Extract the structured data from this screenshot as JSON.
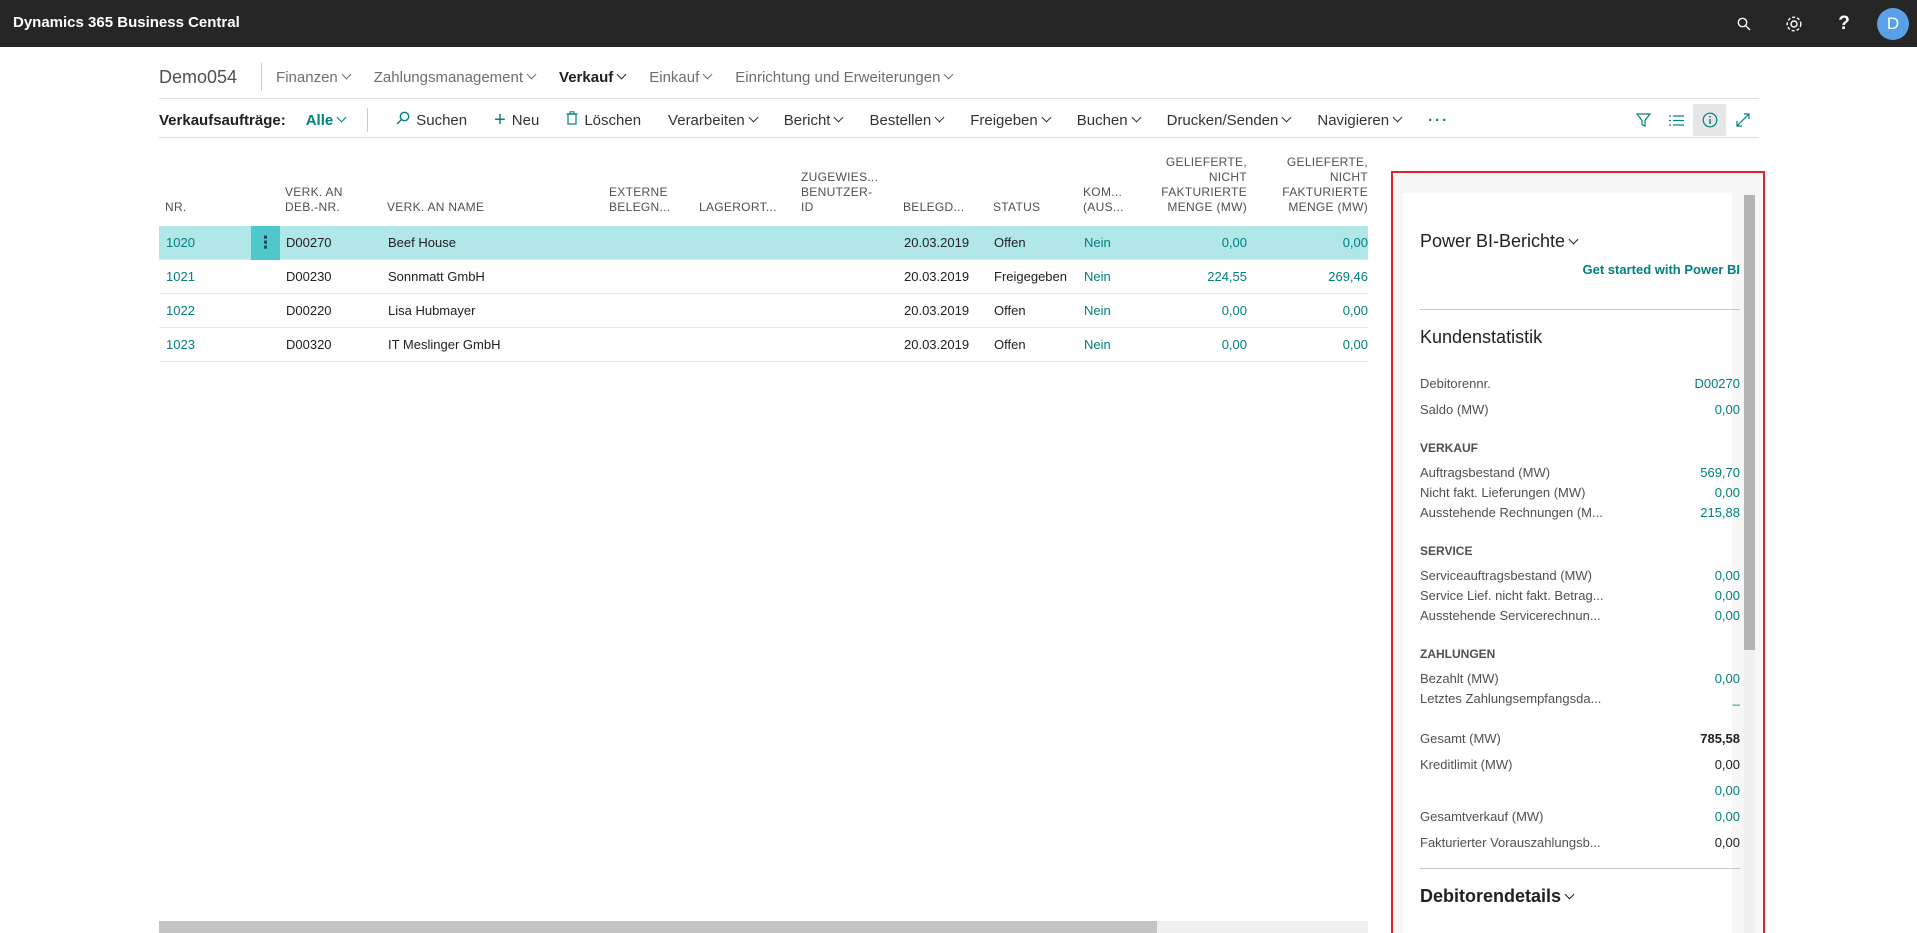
{
  "app": {
    "title": "Dynamics 365 Business Central",
    "avatar_initial": "D",
    "accent": "#00807e",
    "selected_row_color": "#b1e7e8",
    "highlight_border": "#e0242c"
  },
  "topbar_icons": [
    "search-icon",
    "gear-icon",
    "help-icon"
  ],
  "nav": {
    "company": "Demo054",
    "items": [
      {
        "label": "Finanzen",
        "active": false
      },
      {
        "label": "Zahlungsmanagement",
        "active": false
      },
      {
        "label": "Verkauf",
        "active": true
      },
      {
        "label": "Einkauf",
        "active": false
      },
      {
        "label": "Einrichtung und Erweiterungen",
        "active": false
      }
    ]
  },
  "actions": {
    "page_label": "Verkaufsaufträge:",
    "filter": "Alle",
    "search": "Suchen",
    "new": "Neu",
    "delete": "Löschen",
    "menus": [
      "Verarbeiten",
      "Bericht",
      "Bestellen",
      "Freigeben",
      "Buchen",
      "Drucken/Senden",
      "Navigieren"
    ],
    "more": "···"
  },
  "table": {
    "headers": {
      "nr": "NR.",
      "deb_nr": [
        "VERK. AN",
        "DEB.-NR."
      ],
      "name": "VERK. AN NAME",
      "ext": [
        "EXTERNE",
        "BELEGN..."
      ],
      "lager": "LAGERORT...",
      "zugew": [
        "ZUGEWIES...",
        "BENUTZER-",
        "ID"
      ],
      "belegd": "BELEGD...",
      "status": "STATUS",
      "kom": [
        "KOM...",
        "(AUS..."
      ],
      "gel1": [
        "GELIEFERTE,",
        "NICHT",
        "FAKTURIERTE",
        "MENGE (MW)"
      ],
      "gel2": [
        "GELIEFERTE,",
        "NICHT",
        "FAKTURIERTE",
        "MENGE (MW)"
      ]
    },
    "rows": [
      {
        "nr": "1020",
        "deb": "D00270",
        "name": "Beef House",
        "date": "20.03.2019",
        "status": "Offen",
        "kom": "Nein",
        "g1": "0,00",
        "g2": "0,00"
      },
      {
        "nr": "1021",
        "deb": "D00230",
        "name": "Sonnmatt GmbH",
        "date": "20.03.2019",
        "status": "Freigegeben",
        "kom": "Nein",
        "g1": "224,55",
        "g2": "269,46"
      },
      {
        "nr": "1022",
        "deb": "D00220",
        "name": "Lisa Hubmayer",
        "date": "20.03.2019",
        "status": "Offen",
        "kom": "Nein",
        "g1": "0,00",
        "g2": "0,00"
      },
      {
        "nr": "1023",
        "deb": "D00320",
        "name": "IT Meslinger GmbH",
        "date": "20.03.2019",
        "status": "Offen",
        "kom": "Nein",
        "g1": "0,00",
        "g2": "0,00"
      }
    ],
    "row_menu": "⋮"
  },
  "factbox": {
    "powerbi": {
      "title": "Power BI-Berichte",
      "link": "Get started with Power BI"
    },
    "kunden": {
      "title": "Kundenstatistik",
      "debitor_label": "Debitorennr.",
      "debitor_value": "D00270",
      "saldo_label": "Saldo (MW)",
      "saldo_value": "0,00",
      "verkauf": "VERKAUF",
      "auftrag_label": "Auftragsbestand (MW)",
      "auftrag_value": "569,70",
      "nichtfakt_label": "Nicht fakt. Lieferungen (MW)",
      "nichtfakt_value": "0,00",
      "ausst_label": "Ausstehende Rechnungen (M...",
      "ausst_value": "215,88",
      "service": "SERVICE",
      "servauftrag_label": "Serviceauftragsbestand (MW)",
      "servauftrag_value": "0,00",
      "servlief_label": "Service Lief. nicht fakt. Betrag...",
      "servlief_value": "0,00",
      "servausst_label": "Ausstehende Servicerechnun...",
      "servausst_value": "0,00",
      "zahlungen": "ZAHLUNGEN",
      "bezahlt_label": "Bezahlt (MW)",
      "bezahlt_value": "0,00",
      "letztes_label": "Letztes Zahlungsempfangsda...",
      "letztes_value": "_",
      "gesamt_label": "Gesamt (MW)",
      "gesamt_value": "785,58",
      "kredit_label": "Kreditlimit (MW)",
      "kredit_value": "0,00",
      "extra_value": "0,00",
      "gesamtverkauf_label": "Gesamtverkauf (MW)",
      "gesamtverkauf_value": "0,00",
      "voraus_label": "Fakturierter Vorauszahlungsb...",
      "voraus_value": "0,00"
    },
    "debitor": {
      "title": "Debitorendetails"
    }
  }
}
